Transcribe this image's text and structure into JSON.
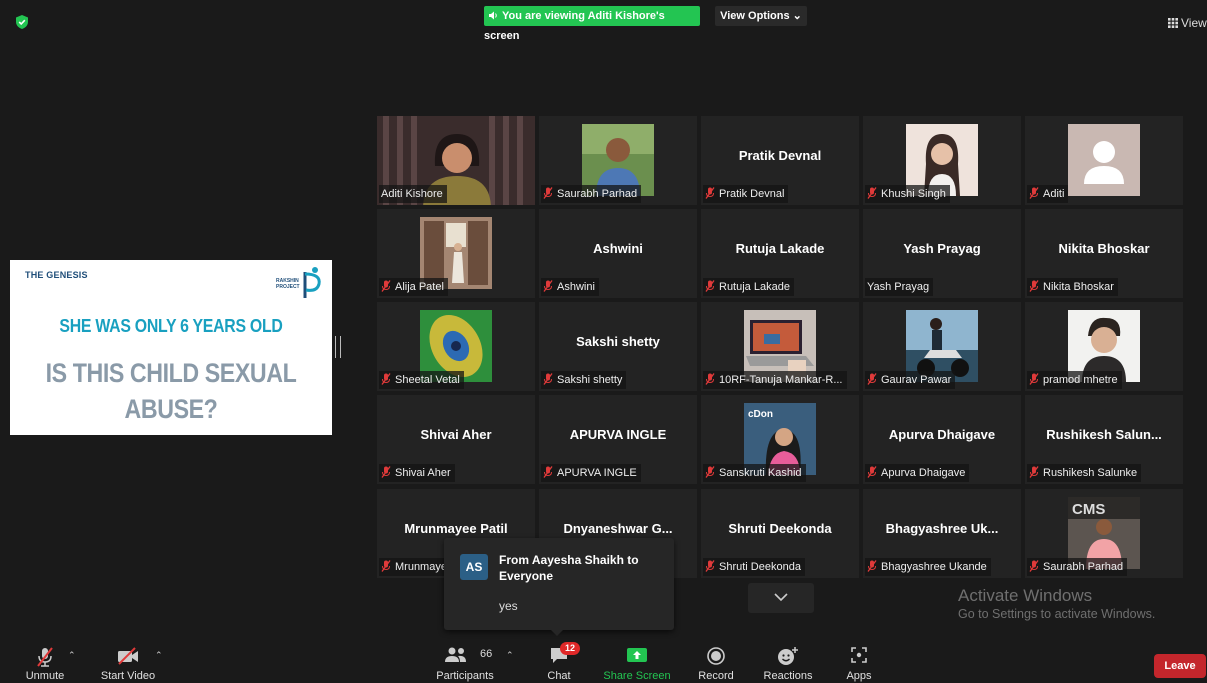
{
  "top_bar": {
    "viewing_text": "You are viewing Aditi Kishore's screen",
    "view_options_label": "View Options",
    "view_label": "View"
  },
  "shared_slide": {
    "brand_left": "THE GENESIS",
    "brand_right": "RAKSHIN PROJECT",
    "line1": "SHE WAS ONLY 6 YEARS OLD",
    "line2a": "IS THIS CHILD SEXUAL",
    "line2b": "ABUSE?"
  },
  "participants": [
    {
      "name": "Aditi Kishore",
      "big": "",
      "muted": false,
      "video": "speaker"
    },
    {
      "name": "Saurabh Parhad",
      "big": "",
      "muted": true,
      "video": "photo-man-green"
    },
    {
      "name": "Pratik Devnal",
      "big": "Pratik Devnal",
      "muted": true,
      "video": ""
    },
    {
      "name": "Khushi Singh",
      "big": "",
      "muted": true,
      "video": "photo-girl"
    },
    {
      "name": "Aditi",
      "big": "",
      "muted": true,
      "video": "avatar-placeholder"
    },
    {
      "name": "Alija Patel",
      "big": "",
      "muted": true,
      "video": "photo-room"
    },
    {
      "name": "Ashwini",
      "big": "Ashwini",
      "muted": true,
      "video": ""
    },
    {
      "name": "Rutuja Lakade",
      "big": "Rutuja Lakade",
      "muted": true,
      "video": ""
    },
    {
      "name": "Yash Prayag",
      "big": "Yash Prayag",
      "muted": false,
      "video": ""
    },
    {
      "name": "Nikita Bhoskar",
      "big": "Nikita Bhoskar",
      "muted": true,
      "video": ""
    },
    {
      "name": "Sheetal Vetal",
      "big": "",
      "muted": true,
      "video": "photo-feather"
    },
    {
      "name": "Sakshi  shetty",
      "big": "Sakshi  shetty",
      "muted": true,
      "video": ""
    },
    {
      "name": "10RF-Tanuja Mankar-R...",
      "big": "",
      "muted": true,
      "video": "photo-laptop"
    },
    {
      "name": "Gaurav Pawar",
      "big": "",
      "muted": true,
      "video": "photo-bike"
    },
    {
      "name": "pramod mhetre",
      "big": "",
      "muted": true,
      "video": "photo-boy"
    },
    {
      "name": "Shivai Aher",
      "big": "Shivai Aher",
      "muted": true,
      "video": ""
    },
    {
      "name": "APURVA INGLE",
      "big": "APURVA INGLE",
      "muted": true,
      "video": ""
    },
    {
      "name": "Sanskruti Kashid",
      "big": "",
      "muted": true,
      "video": "photo-woman-pink"
    },
    {
      "name": "Apurva Dhaigave",
      "big": "Apurva Dhaigave",
      "muted": true,
      "video": ""
    },
    {
      "name": "Rushikesh Salunke",
      "big": "Rushikesh  Salun...",
      "muted": true,
      "video": ""
    },
    {
      "name": "Mrunmayee Patil",
      "big": "Mrunmayee Patil",
      "muted": true,
      "video": ""
    },
    {
      "name": "",
      "big": "Dnyaneshwar  G...",
      "muted": false,
      "video": ""
    },
    {
      "name": "Shruti Deekonda",
      "big": "Shruti Deekonda",
      "muted": true,
      "video": ""
    },
    {
      "name": "Bhagyashree Ukande",
      "big": "Bhagyashree  Uk...",
      "muted": true,
      "video": ""
    },
    {
      "name": "Saurabh Parhad",
      "big": "",
      "muted": true,
      "video": "photo-man-sign"
    }
  ],
  "chat_popup": {
    "avatar_initials": "AS",
    "from_line": "From Aayesha Shaikh to Everyone",
    "message": "yes"
  },
  "watermark": {
    "line1": "Activate Windows",
    "line2": "Go to Settings to activate Windows."
  },
  "toolbar": {
    "unmute": "Unmute",
    "start_video": "Start Video",
    "participants": "Participants",
    "participants_count": "66",
    "chat": "Chat",
    "chat_badge": "12",
    "share_screen": "Share Screen",
    "record": "Record",
    "reactions": "Reactions",
    "apps": "Apps",
    "leave": "Leave"
  },
  "colors": {
    "background": "#1a1a1a",
    "tile": "#232323",
    "active_speaker": "#e6ff6e",
    "viewing_banner": "#23c552",
    "leave": "#c4262c",
    "muted_red": "#e03a3a",
    "share_green": "#23c552",
    "slide_cyan": "#19a0c0",
    "slide_grey": "#8a9aa8"
  }
}
